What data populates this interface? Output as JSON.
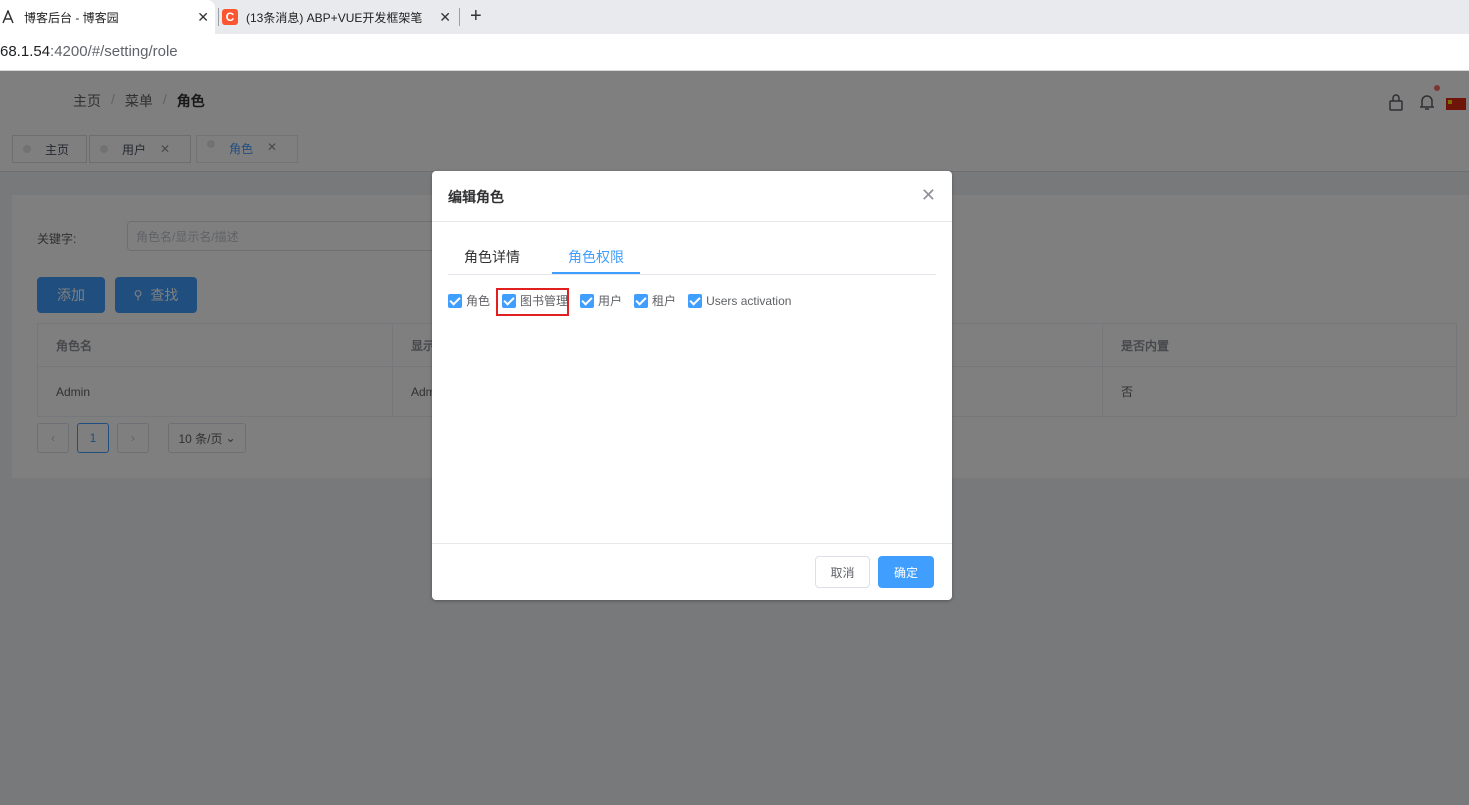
{
  "browser": {
    "tabs": [
      {
        "title": "博客后台 - 博客园",
        "active": true
      },
      {
        "title": "(13条消息) ABP+VUE开发框架笔",
        "active": false
      }
    ],
    "url_host": "68.1.54",
    "url_rest": ":4200/#/setting/role"
  },
  "header": {
    "breadcrumbs": [
      "主页",
      "菜单",
      "角色"
    ]
  },
  "tags_view": [
    {
      "label": "主页",
      "closable": false,
      "active": false
    },
    {
      "label": "用户",
      "closable": true,
      "active": false
    },
    {
      "label": "角色",
      "closable": true,
      "active": true
    }
  ],
  "filter": {
    "keyword_label": "关键字:",
    "keyword_placeholder": "角色名/显示名/描述"
  },
  "buttons": {
    "add": "添加",
    "search": "查找"
  },
  "table": {
    "columns": [
      "角色名",
      "显示",
      "是否内置"
    ],
    "rows": [
      {
        "name": "Admin",
        "display": "Adm",
        "is_static": "否"
      }
    ]
  },
  "pagination": {
    "current_page": "1",
    "page_size": "10 条/页"
  },
  "dialog": {
    "title": "编辑角色",
    "tabs": [
      "角色详情",
      "角色权限"
    ],
    "active_tab": "角色权限",
    "permissions": [
      {
        "label": "角色",
        "checked": true
      },
      {
        "label": "图书管理",
        "checked": true
      },
      {
        "label": "用户",
        "checked": true
      },
      {
        "label": "租户",
        "checked": true
      },
      {
        "label": "Users activation",
        "checked": true
      }
    ],
    "cancel": "取消",
    "ok": "确定"
  },
  "colors": {
    "primary": "#409eff",
    "highlight": "#e02020",
    "notify_dot": "#f56c6c"
  }
}
